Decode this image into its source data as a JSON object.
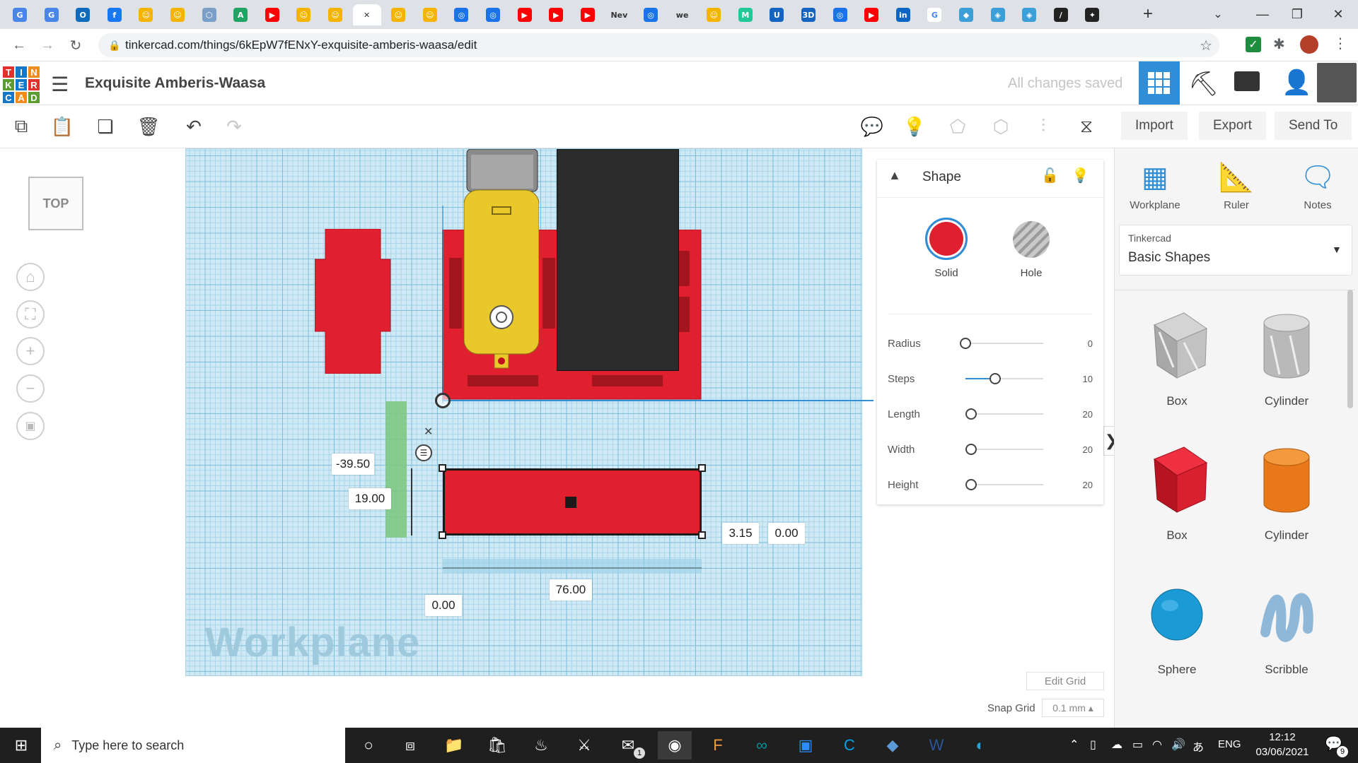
{
  "browser": {
    "tabs": [
      {
        "icon": "google-docs-icon",
        "color": "#4a86e8",
        "glyph": "G"
      },
      {
        "icon": "google-docs-icon",
        "color": "#4a86e8",
        "glyph": "G"
      },
      {
        "icon": "outlook-icon",
        "color": "#0f6cbd",
        "glyph": "O"
      },
      {
        "icon": "facebook-icon",
        "color": "#1877f2",
        "glyph": "f"
      },
      {
        "icon": "tinkercad-avatar-icon",
        "color": "#f4b400",
        "glyph": "☺"
      },
      {
        "icon": "tinkercad-avatar-icon",
        "color": "#f4b400",
        "glyph": "☺"
      },
      {
        "icon": "shield-icon",
        "color": "#7aa0c8",
        "glyph": "⬡"
      },
      {
        "icon": "drive-icon",
        "color": "#1fa463",
        "glyph": "A"
      },
      {
        "icon": "youtube-icon",
        "color": "#ff0000",
        "glyph": "▶"
      },
      {
        "icon": "tinkercad-avatar-icon",
        "color": "#f4b400",
        "glyph": "☺"
      },
      {
        "icon": "tinkercad-avatar-icon",
        "color": "#f4b400",
        "glyph": "☺"
      },
      {
        "icon": "close-icon",
        "color": "#ffffff",
        "glyph": "✕",
        "active": true
      },
      {
        "icon": "tinkercad-avatar-icon",
        "color": "#f4b400",
        "glyph": "☺"
      },
      {
        "icon": "tinkercad-avatar-icon",
        "color": "#f4b400",
        "glyph": "☺"
      },
      {
        "icon": "generic-circle-icon",
        "color": "#1a73e8",
        "glyph": "◎"
      },
      {
        "icon": "generic-circle-icon",
        "color": "#1a73e8",
        "glyph": "◎"
      },
      {
        "icon": "youtube-icon",
        "color": "#ff0000",
        "glyph": "▶"
      },
      {
        "icon": "youtube-icon",
        "color": "#ff0000",
        "glyph": "▶"
      },
      {
        "icon": "youtube-icon",
        "color": "#ff0000",
        "glyph": "▶"
      },
      {
        "icon": "text-icon",
        "color": "#dee1e6",
        "glyph": "Nev",
        "text": true
      },
      {
        "icon": "generic-circle-icon",
        "color": "#1a73e8",
        "glyph": "◎"
      },
      {
        "icon": "we-icon",
        "color": "#dee1e6",
        "glyph": "we",
        "text": true
      },
      {
        "icon": "tinkercad-avatar-icon",
        "color": "#f4b400",
        "glyph": "☺"
      },
      {
        "icon": "m-icon",
        "color": "#20c997",
        "glyph": "M"
      },
      {
        "icon": "u-icon",
        "color": "#1565c0",
        "glyph": "U"
      },
      {
        "icon": "3d-icon",
        "color": "#1565c0",
        "glyph": "3D"
      },
      {
        "icon": "generic-circle-icon",
        "color": "#1a73e8",
        "glyph": "◎"
      },
      {
        "icon": "youtube-icon",
        "color": "#ff0000",
        "glyph": "▶"
      },
      {
        "icon": "linkedin-icon",
        "color": "#0a66c2",
        "glyph": "in"
      },
      {
        "icon": "google-icon",
        "color": "#ffffff",
        "glyph": "G"
      },
      {
        "icon": "chip-icon",
        "color": "#3c9fd8",
        "glyph": "◆"
      },
      {
        "icon": "stack-icon",
        "color": "#3c9fd8",
        "glyph": "◈"
      },
      {
        "icon": "stack-icon",
        "color": "#3c9fd8",
        "glyph": "◈"
      },
      {
        "icon": "slash-icon",
        "color": "#222222",
        "glyph": "/"
      },
      {
        "icon": "spark-icon",
        "color": "#222222",
        "glyph": "✦"
      }
    ],
    "url": "tinkercad.com/things/6kEpW7fENxY-exquisite-amberis-waasa/edit"
  },
  "app": {
    "logo_letters": [
      "T",
      "I",
      "N",
      "K",
      "E",
      "R",
      "C",
      "A",
      "D"
    ],
    "design_title": "Exquisite Amberis-Waasa",
    "save_status": "All changes saved"
  },
  "toolbar": {
    "import_label": "Import",
    "export_label": "Export",
    "sendto_label": "Send To"
  },
  "viewcube": {
    "label": "TOP"
  },
  "workplane": {
    "watermark": "Workplane"
  },
  "dimensions": {
    "y_position": "-39.50",
    "depth": "19.00",
    "x_offset": "3.15",
    "z_offset": "0.00",
    "x_origin": "0.00",
    "width": "76.00"
  },
  "shape_panel": {
    "title": "Shape",
    "solid_label": "Solid",
    "hole_label": "Hole",
    "params": [
      {
        "label": "Radius",
        "value": "0"
      },
      {
        "label": "Steps",
        "value": "10"
      },
      {
        "label": "Length",
        "value": "20"
      },
      {
        "label": "Width",
        "value": "20"
      },
      {
        "label": "Height",
        "value": "20"
      }
    ]
  },
  "library": {
    "tools": [
      {
        "label": "Workplane",
        "icon": "workplane-icon"
      },
      {
        "label": "Ruler",
        "icon": "ruler-icon"
      },
      {
        "label": "Notes",
        "icon": "notes-icon"
      }
    ],
    "provider": "Tinkercad",
    "category": "Basic Shapes",
    "shapes": [
      {
        "label": "Box",
        "icon": "box-hole-icon"
      },
      {
        "label": "Cylinder",
        "icon": "cylinder-hole-icon"
      },
      {
        "label": "Box",
        "icon": "box-solid-icon"
      },
      {
        "label": "Cylinder",
        "icon": "cylinder-solid-icon"
      },
      {
        "label": "Sphere",
        "icon": "sphere-icon"
      },
      {
        "label": "Scribble",
        "icon": "scribble-icon"
      }
    ]
  },
  "grid_settings": {
    "edit_grid_label": "Edit Grid",
    "snap_grid_label": "Snap Grid",
    "snap_value": "0.1 mm"
  },
  "taskbar": {
    "search_placeholder": "Type here to search",
    "language": "ENG",
    "time": "12:12",
    "date": "03/06/2021",
    "notification_count": "9",
    "mail_badge": "1"
  }
}
